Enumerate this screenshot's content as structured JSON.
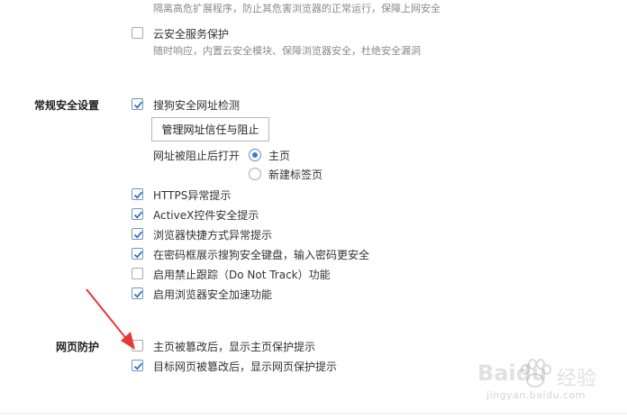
{
  "top": {
    "partial_desc": "隔离高危扩展程序，防止其危害浏览器的正常运行，保障上网安全",
    "cloud": {
      "label": "云安全服务保护",
      "desc": "随时响应，内置云安全模块、保障浏览器安全，杜绝安全漏洞",
      "checked": false
    }
  },
  "general": {
    "title": "常规安全设置",
    "url_check": {
      "label": "搜狗安全网址检测",
      "checked": true
    },
    "manage_button": "管理网址信任与阻止",
    "blocked_open": {
      "label": "网址被阻止后打开",
      "options": [
        {
          "label": "主页",
          "selected": true
        },
        {
          "label": "新建标签页",
          "selected": false
        }
      ]
    },
    "items": [
      {
        "label": "HTTPS异常提示",
        "checked": true
      },
      {
        "label": "ActiveX控件安全提示",
        "checked": true
      },
      {
        "label": "浏览器快捷方式异常提示",
        "checked": true
      },
      {
        "label": "在密码框展示搜狗安全键盘，输入密码更安全",
        "checked": true
      },
      {
        "label": "启用禁止跟踪（Do Not Track）功能",
        "checked": false
      },
      {
        "label": "启用浏览器安全加速功能",
        "checked": true
      }
    ]
  },
  "web": {
    "title": "网页防护",
    "items": [
      {
        "label": "主页被篡改后，显示主页保护提示",
        "checked": false
      },
      {
        "label": "目标网页被篡改后，显示网页保护提示",
        "checked": true
      }
    ]
  },
  "annotation": {
    "arrow_color": "#e53935"
  },
  "watermark": {
    "brand": "Baidu",
    "cn": "经验",
    "url": "jingyan.baidu.com"
  },
  "colors": {
    "check": "#2f6fc4",
    "radio": "#3a7bd5"
  }
}
